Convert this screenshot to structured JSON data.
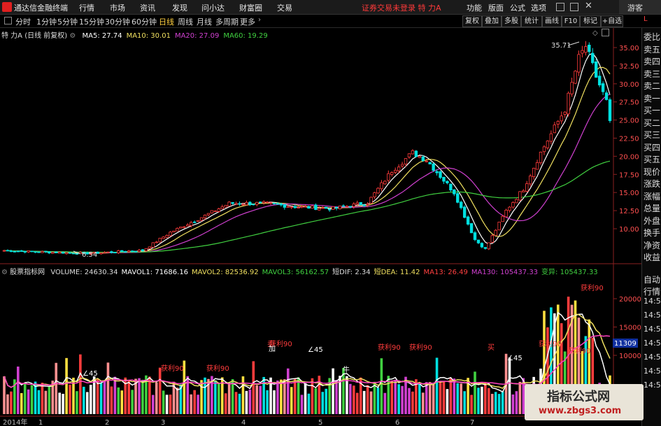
{
  "app": {
    "title": "通达信金融终端",
    "alert": "证券交易未登录 特 力A",
    "user": "游客",
    "badge": "L"
  },
  "menu": {
    "items": [
      "行情",
      "市场",
      "资讯",
      "发现",
      "问小达",
      "财富圈",
      "交易"
    ],
    "right_items": [
      "功能",
      "版面",
      "公式",
      "选项"
    ]
  },
  "periods": {
    "items": [
      "分时",
      "1分钟",
      "5分钟",
      "15分钟",
      "30分钟",
      "60分钟",
      "日线",
      "周线",
      "月线",
      "多周期",
      "更多"
    ],
    "active": "日线"
  },
  "toolbar": {
    "items": [
      "复权",
      "叠加",
      "多股",
      "统计",
      "画线",
      "F10",
      "标记",
      "+自选"
    ]
  },
  "right_panel": {
    "items": [
      "委比",
      "卖五",
      "卖四",
      "卖三",
      "卖二",
      "卖一",
      "买一",
      "买二",
      "买三",
      "买四",
      "买五",
      "现价",
      "涨跌",
      "涨幅",
      "总量",
      "外盘",
      "换手",
      "净资",
      "收益",
      "自动",
      "行情"
    ]
  },
  "main_chart": {
    "name": "特 力A",
    "mode": "(日线 前复权)",
    "indicators": [
      {
        "label": "MA5: 27.74",
        "color": "#ffffff"
      },
      {
        "label": "MA10: 30.01",
        "color": "#f0e060"
      },
      {
        "label": "MA20: 27.09",
        "color": "#d040d0"
      },
      {
        "label": "MA60: 19.29",
        "color": "#40d040"
      }
    ],
    "price_axis": [
      "35.00",
      "32.50",
      "30.00",
      "27.50",
      "25.00",
      "22.50",
      "20.00",
      "17.50",
      "15.00",
      "12.50",
      "10.00"
    ],
    "high_label": "35.71",
    "low_label": "6.54",
    "up_color": "#ff3c3c",
    "down_color": "#00e0e0"
  },
  "volume_chart": {
    "name": "股票指标网",
    "indicators": [
      {
        "label": "VOLUME: 24630.34",
        "color": "#dddddd"
      },
      {
        "label": "MAVOL1: 71686.16",
        "color": "#ffffff"
      },
      {
        "label": "MAVOL2: 82536.92",
        "color": "#f0e060"
      },
      {
        "label": "MAVOL3: 56162.57",
        "color": "#40d040"
      },
      {
        "label": "短DIF: 2.34",
        "color": "#dddddd"
      },
      {
        "label": "短DEA: 11.42",
        "color": "#f0e060"
      },
      {
        "label": "MA13: 26.49",
        "color": "#ff4040"
      },
      {
        "label": "MA130: 105437.33",
        "color": "#d040d0"
      },
      {
        "label": "变异: 105437.33",
        "color": "#40d040"
      }
    ],
    "axis": [
      "20000",
      "15000",
      "10000"
    ],
    "current_badge": "11309",
    "labels": [
      "获利90",
      "获利90",
      "获利90",
      "获利90",
      "获利90",
      "获利90",
      "获利90",
      "获利90",
      "∠45",
      "∠45",
      "∠45",
      "买",
      "卖",
      "加",
      "牛"
    ]
  },
  "time_axis": {
    "labels": [
      "2014年",
      "1",
      "2",
      "3",
      "4",
      "5",
      "6",
      "7"
    ]
  },
  "time_panel": {
    "items": [
      "14:50",
      "14:50",
      "14:50",
      "14:50",
      "14:50",
      "14:50",
      "14:50"
    ]
  },
  "watermark": {
    "title": "指标公式网",
    "url": "www.zbgs3.com"
  }
}
